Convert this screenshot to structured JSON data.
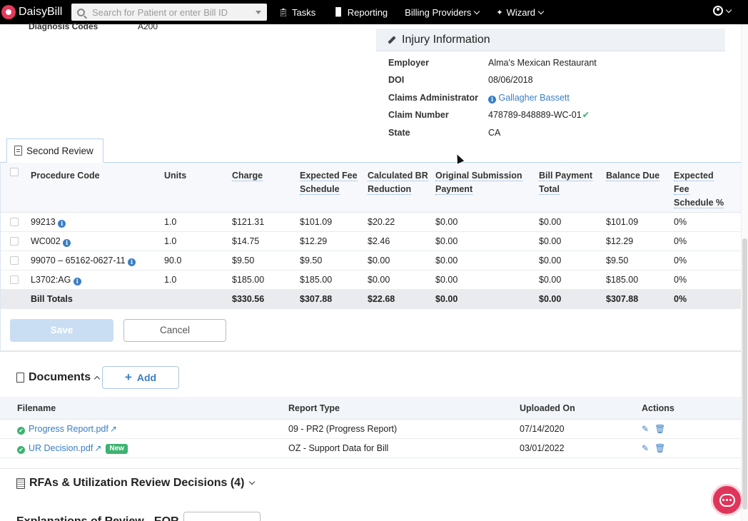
{
  "nav": {
    "brand": "DaisyBill",
    "search_placeholder": "Search for Patient or enter Bill ID",
    "items": [
      {
        "label": "Tasks",
        "icon": "clipboard-icon"
      },
      {
        "label": "Reporting",
        "icon": "bar-chart-icon"
      },
      {
        "label": "Billing Providers",
        "icon": ""
      },
      {
        "label": "Wizard",
        "icon": "magic-wand-icon"
      }
    ]
  },
  "diagnosis": {
    "label": "Diagnosis Codes",
    "value": "A200"
  },
  "injury": {
    "title": "Injury Information",
    "rows": [
      {
        "label": "Employer",
        "value": "Alma's Mexican Restaurant"
      },
      {
        "label": "DOI",
        "value": "08/06/2018"
      },
      {
        "label": "Claims Administrator",
        "value": "Gallagher Bassett"
      },
      {
        "label": "Claim Number",
        "value": "478789-848889-WC-01"
      },
      {
        "label": "State",
        "value": "CA"
      }
    ]
  },
  "review": {
    "tab_label": "Second Review",
    "headers": [
      "Procedure Code",
      "Units",
      "Charge",
      "Expected Fee Schedule",
      "Calculated BR Reduction",
      "Original Submission Payment",
      "Bill Payment Total",
      "Balance Due",
      "Expected Fee Schedule %"
    ],
    "rows": [
      {
        "code": "99213",
        "units": "1.0",
        "charge": "$121.31",
        "expected": "$101.09",
        "br": "$20.22",
        "orig": "$0.00",
        "paid": "$0.00",
        "balance": "$101.09",
        "pct": "0%"
      },
      {
        "code": "WC002",
        "units": "1.0",
        "charge": "$14.75",
        "expected": "$12.29",
        "br": "$2.46",
        "orig": "$0.00",
        "paid": "$0.00",
        "balance": "$12.29",
        "pct": "0%"
      },
      {
        "code": "99070 – 65162-0627-11",
        "units": "90.0",
        "charge": "$9.50",
        "expected": "$9.50",
        "br": "$0.00",
        "orig": "$0.00",
        "paid": "$0.00",
        "balance": "$9.50",
        "pct": "0%"
      },
      {
        "code": "L3702:AG",
        "units": "1.0",
        "charge": "$185.00",
        "expected": "$185.00",
        "br": "$0.00",
        "orig": "$0.00",
        "paid": "$0.00",
        "balance": "$185.00",
        "pct": "0%"
      }
    ],
    "totals": {
      "label": "Bill Totals",
      "charge": "$330.56",
      "expected": "$307.88",
      "br": "$22.68",
      "orig": "$0.00",
      "paid": "$0.00",
      "balance": "$307.88",
      "pct": "0%"
    },
    "save_label": "Save",
    "cancel_label": "Cancel"
  },
  "documents": {
    "title": "Documents",
    "add_label": "Add",
    "headers": [
      "Filename",
      "Report Type",
      "Uploaded On",
      "Actions"
    ],
    "rows": [
      {
        "filename": "Progress Report.pdf",
        "badge": "",
        "type": "09 - PR2 (Progress Report)",
        "uploaded": "07/14/2020"
      },
      {
        "filename": "UR Decision.pdf",
        "badge": "New",
        "type": "OZ - Support Data for Bill",
        "uploaded": "03/01/2022"
      }
    ]
  },
  "rfas": {
    "title": "RFAs & Utilization Review Decisions (4)"
  },
  "eob": {
    "title": "Explanations of Review - EOR"
  },
  "colors": {
    "brand": "#e23a5b",
    "link": "#3a7ec3",
    "success": "#3cb371"
  }
}
